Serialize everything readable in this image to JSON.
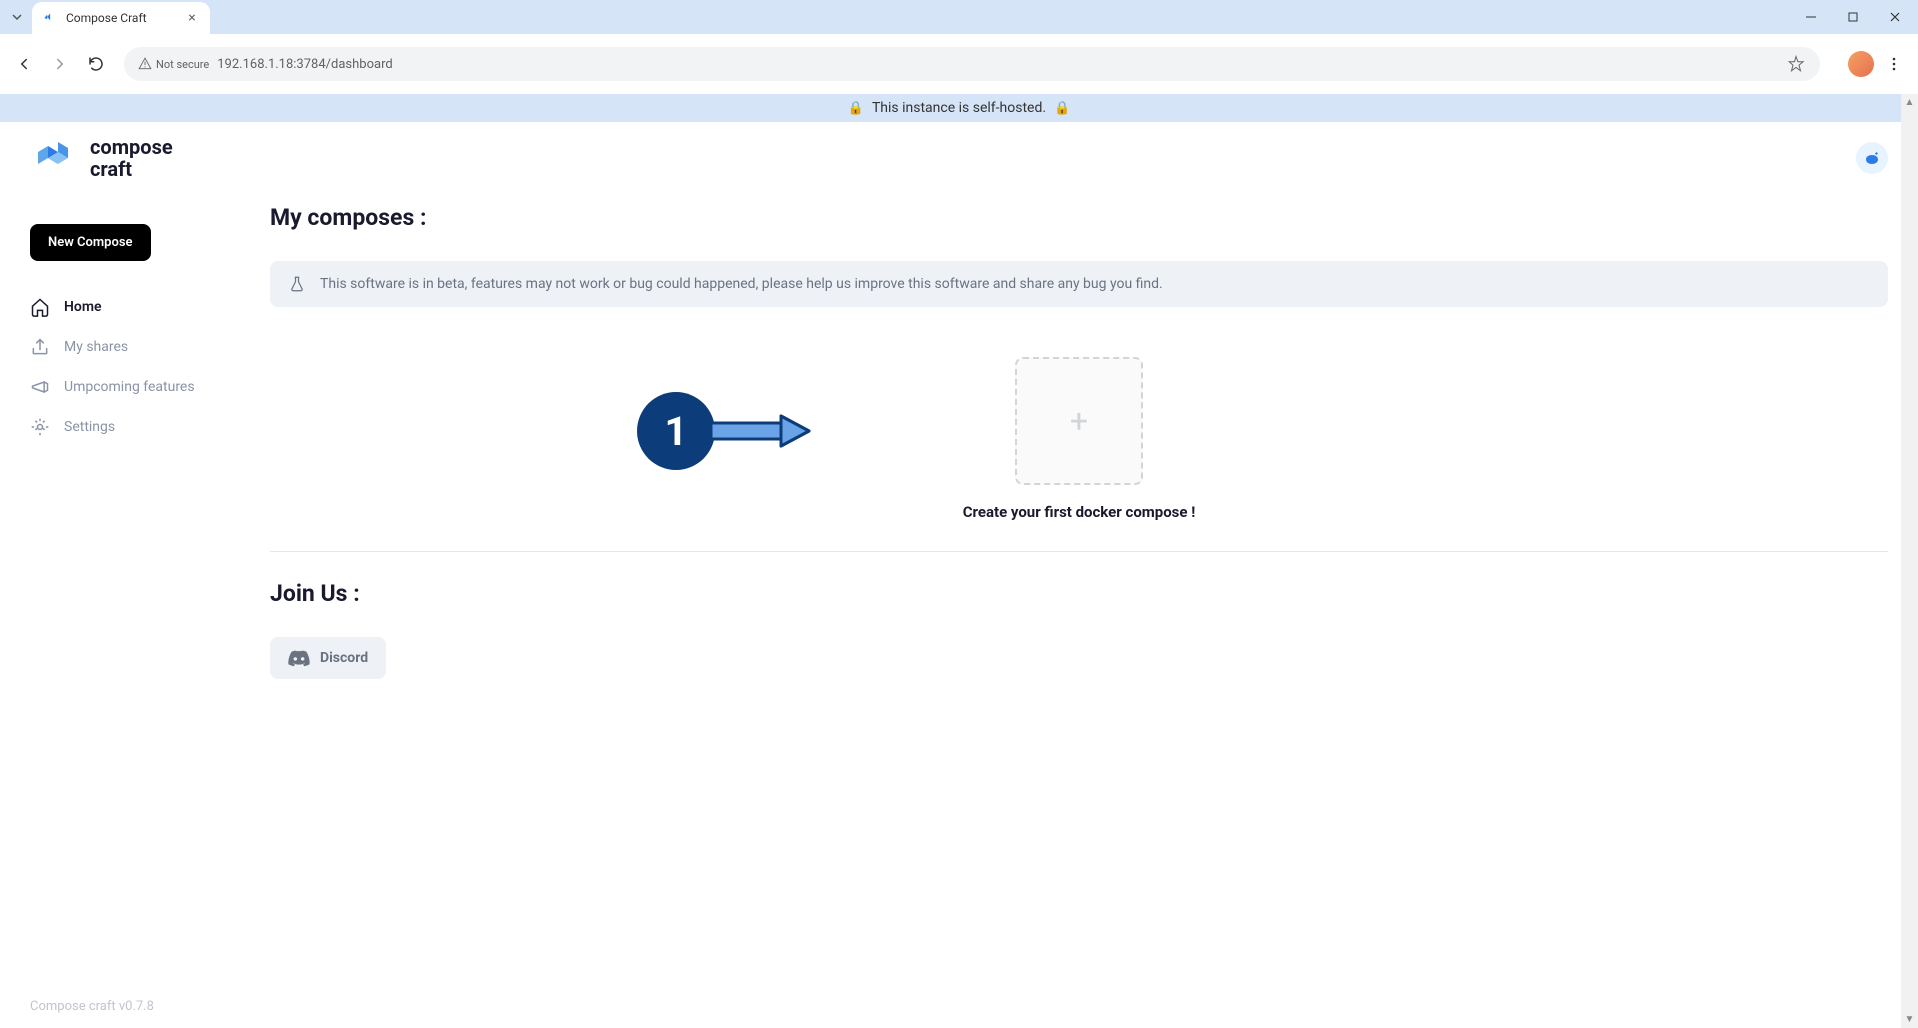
{
  "browser": {
    "tab_title": "Compose Craft",
    "security_label": "Not secure",
    "url": "192.168.1.18:3784/dashboard"
  },
  "banner": {
    "text": "This instance is self-hosted."
  },
  "app": {
    "logo_top": "compose",
    "logo_bottom": "craft"
  },
  "sidebar": {
    "new_compose_label": "New Compose",
    "items": [
      {
        "label": "Home"
      },
      {
        "label": "My shares"
      },
      {
        "label": "Umpcoming features"
      },
      {
        "label": "Settings"
      }
    ]
  },
  "main": {
    "composes_title": "My composes :",
    "info_text": "This software is in beta, features may not work or bug could happened, please help us improve this software and share any bug you find.",
    "step_number": "1",
    "create_caption": "Create your first docker compose !",
    "join_us_title": "Join Us :",
    "discord_label": "Discord"
  },
  "footer": {
    "version": "Compose craft v0.7.8"
  }
}
